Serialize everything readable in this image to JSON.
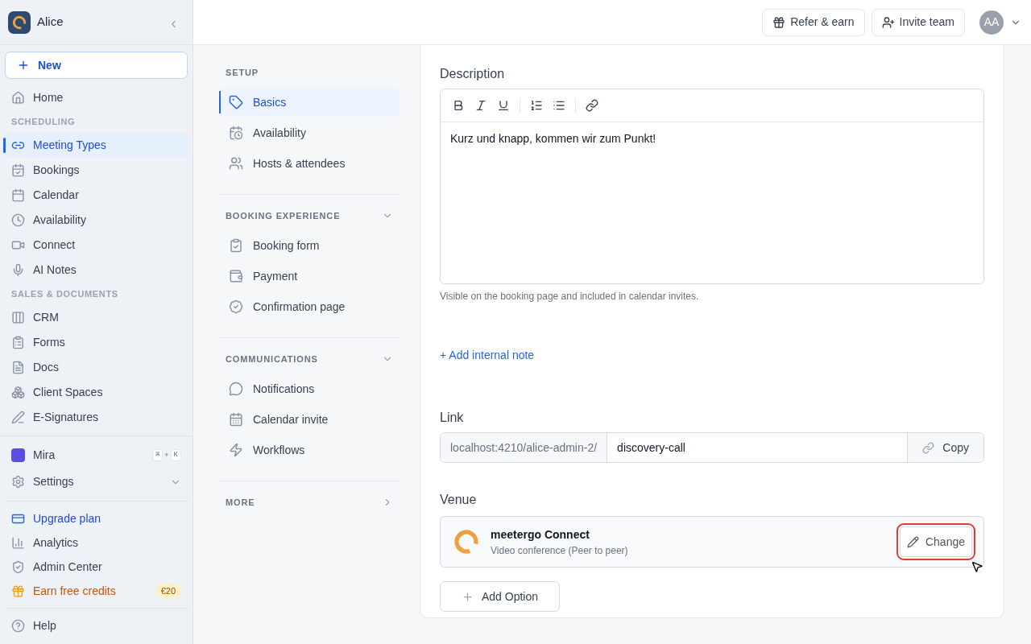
{
  "sidebar": {
    "workspace": "Alice",
    "collapse_label": "‹",
    "new_button": "New",
    "nav": [
      {
        "kind": "item",
        "label": "Home",
        "selected": false
      },
      {
        "kind": "section",
        "label": "SCHEDULING"
      },
      {
        "kind": "item",
        "label": "Meeting Types",
        "selected": true
      },
      {
        "kind": "item",
        "label": "Bookings",
        "selected": false
      },
      {
        "kind": "item",
        "label": "Calendar",
        "selected": false
      },
      {
        "kind": "item",
        "label": "Availability",
        "selected": false
      },
      {
        "kind": "item",
        "label": "Connect",
        "selected": false
      },
      {
        "kind": "item",
        "label": "AI Notes",
        "selected": false
      },
      {
        "kind": "section",
        "label": "SALES & DOCUMENTS"
      },
      {
        "kind": "item",
        "label": "CRM",
        "selected": false
      },
      {
        "kind": "item",
        "label": "Forms",
        "selected": false
      },
      {
        "kind": "item",
        "label": "Docs",
        "selected": false
      },
      {
        "kind": "item",
        "label": "Client Spaces",
        "selected": false
      },
      {
        "kind": "item",
        "label": "E-Signatures",
        "selected": false
      }
    ],
    "assistant": {
      "label": "Mira",
      "keys": [
        "⌘",
        "K"
      ],
      "joiner": "+"
    },
    "settings": {
      "label": "Settings",
      "expanded": false
    },
    "footer": [
      {
        "kind": "upgrade",
        "label": "Upgrade plan"
      },
      {
        "kind": "plain",
        "label": "Analytics"
      },
      {
        "kind": "plain",
        "label": "Admin Center"
      },
      {
        "kind": "credits",
        "label": "Earn free credits",
        "badge": "€20"
      }
    ],
    "help": "Help"
  },
  "header": {
    "buttons": [
      "Refer & earn",
      "Invite team"
    ],
    "avatar": "AA"
  },
  "settings_nav": [
    {
      "title": "SETUP",
      "items": [
        {
          "label": "Basics",
          "selected": true
        },
        {
          "label": "Availability",
          "selected": false
        },
        {
          "label": "Hosts & attendees",
          "selected": false
        }
      ]
    },
    {
      "title": "BOOKING EXPERIENCE",
      "expanded": true,
      "items": [
        {
          "label": "Booking form",
          "selected": false
        },
        {
          "label": "Payment",
          "selected": false
        },
        {
          "label": "Confirmation page",
          "selected": false
        }
      ]
    },
    {
      "title": "COMMUNICATIONS",
      "expanded": true,
      "items": [
        {
          "label": "Notifications",
          "selected": false
        },
        {
          "label": "Calendar invite",
          "selected": false
        },
        {
          "label": "Workflows",
          "selected": false
        }
      ]
    },
    {
      "title": "MORE",
      "expanded": false
    }
  ],
  "form": {
    "description": {
      "label": "Description",
      "value": "Kurz und knapp, kommen wir zum Punkt!",
      "hint": "Visible on the booking page and included in calendar invites."
    },
    "internal_note_link": "+ Add internal note",
    "link": {
      "label": "Link",
      "prefix": "localhost:4210/alice-admin-2/",
      "slug": "discovery-call",
      "copy_button": "Copy"
    },
    "venue": {
      "label": "Venue",
      "name": "meetergo Connect",
      "subtitle": "Video conference (Peer to peer)",
      "change_button": "Change",
      "highlighted": true,
      "add_button": "Add Option"
    }
  }
}
